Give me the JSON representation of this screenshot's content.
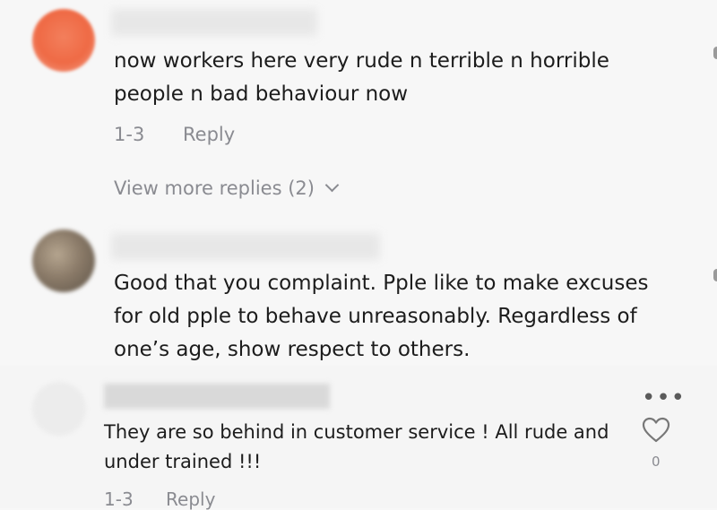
{
  "comments": [
    {
      "text_lines": [
        "now workers here very rude n terrible n horrible",
        "people n bad behaviour now"
      ],
      "date": "1-3",
      "reply_label": "Reply",
      "more_replies": "View more replies (2)",
      "avatar_color": "#ef6a45"
    },
    {
      "text_lines": [
        "Good that you complaint. Pple like to make excuses",
        "for old pple to behave unreasonably. Regardless of",
        "one’s age, show respect to others."
      ],
      "avatar_color": "#8a7a68"
    },
    {
      "text_lines": [
        "They are so behind in customer service ! All rude and",
        "under trained !!!"
      ],
      "date": "1-3",
      "reply_label": "Reply",
      "like_count": "0",
      "more_icon": "more-options-icon",
      "like_icon": "heart-icon",
      "avatar_color": "#ededed"
    }
  ]
}
